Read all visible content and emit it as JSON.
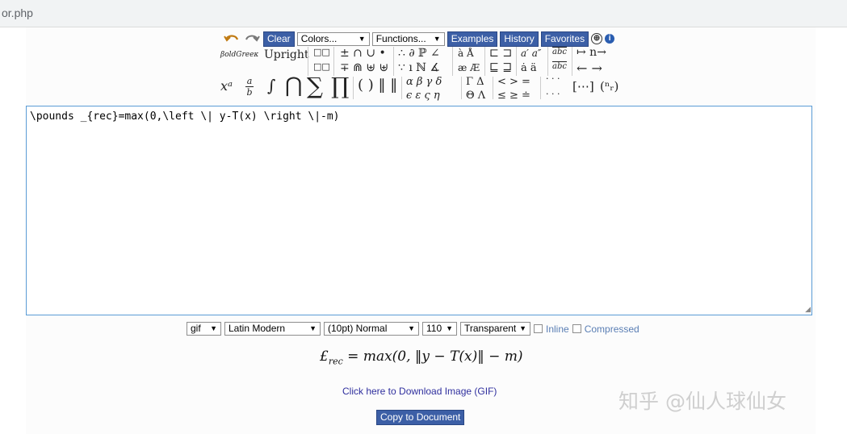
{
  "address_bar": {
    "text": "or.php"
  },
  "toolbar": {
    "clear_label": "Clear",
    "colors_select": "Colors...",
    "functions_select": "Functions...",
    "examples_label": "Examples",
    "history_label": "History",
    "favorites_label": "Favorites",
    "plus_symbol": "⊕",
    "info_symbol": "i"
  },
  "symbols": {
    "boldgreek": "βoldGreeκ",
    "upright": "Upright",
    "g1": [
      "□□",
      "□□"
    ],
    "g2": [
      "± ∩ ∪ •",
      "∓ ⋒ ⊎ ⊎"
    ],
    "g3": [
      "∴ ∂ ℙ ∠",
      "∵ ı ℕ ∡"
    ],
    "g4": [
      "à Å",
      "æ Æ"
    ],
    "g5": [
      "⊏ ⊐",
      "⊑ ⊒"
    ],
    "g6": [
      "a′ a″",
      "ȧ ä"
    ],
    "g7": [
      "abc",
      "abc"
    ],
    "g8": [
      "↦ n→",
      "← →"
    ],
    "r3_superscript": "xᵃ",
    "r3_fraction_num": "a",
    "r3_fraction_den": "b",
    "r3_integral": "∫",
    "r3_bigcap": "⋂",
    "r3_sum": "∑",
    "r3_prod": "∏",
    "r3_delims": "( ) ‖ ‖",
    "r3_greek": [
      "α β γ δ",
      "ϵ ε ς η"
    ],
    "r3_capgreek": [
      "Γ Δ",
      "Θ Λ"
    ],
    "r3_rel": [
      "< > =",
      "≤ ≥ ≐"
    ],
    "r3_dots": [
      "· · ·",
      "· · ·"
    ],
    "r3_matrix": "[⋯]",
    "r3_binom": "(ⁿᵣ)"
  },
  "editor": {
    "code": "\\pounds _{rec}=max(0,\\left \\| y-T(x) \\right \\|-m)"
  },
  "options": {
    "format": "gif",
    "font": "Latin Modern",
    "size": "(10pt) Normal",
    "dpi": "110",
    "background": "Transparent",
    "inline_label": "Inline",
    "compressed_label": "Compressed"
  },
  "result": {
    "lhs": "£",
    "sub": "rec",
    "rhs": " = max(0, ‖y − T(x)‖ − m)"
  },
  "download_link": "Click here to Download Image (GIF)",
  "copy_button": "Copy to Document",
  "watermark": "知乎 @仙人球仙女"
}
